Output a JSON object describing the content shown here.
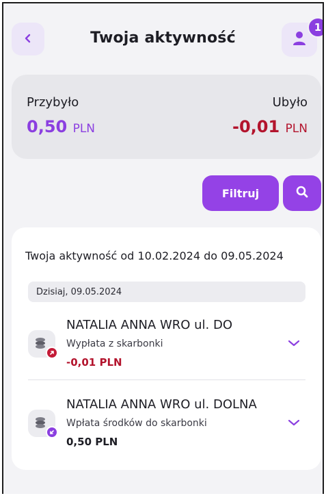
{
  "header": {
    "title": "Twoja aktywność",
    "notification_count": "1"
  },
  "summary": {
    "in_label": "Przybyło",
    "in_amount": "0,50",
    "in_currency": "PLN",
    "out_label": "Ubyło",
    "out_amount": "-0,01",
    "out_currency": "PLN"
  },
  "actions": {
    "filter_label": "Filtruj"
  },
  "activity": {
    "period": "Twoja aktywność od 10.02.2024 do 09.05.2024",
    "date_header": "Dzisiaj, 09.05.2024",
    "transactions": [
      {
        "name": "NATALIA ANNA WRO ul. DO",
        "description": "Wypłata z skarbonki",
        "amount": "-0,01 PLN",
        "direction": "out"
      },
      {
        "name": "NATALIA ANNA WRO ul. DOLNA",
        "description": "Wpłata środków do skarbonki",
        "amount": "0,50 PLN",
        "direction": "in"
      }
    ]
  },
  "colors": {
    "accent": "#9442e6",
    "negative": "#b3142d",
    "background": "#f3f3f6"
  },
  "icons": {
    "back": "chevron-left-icon",
    "profile": "user-icon",
    "search": "search-icon",
    "transaction": "coins-icon",
    "expand": "chevron-down-icon"
  }
}
